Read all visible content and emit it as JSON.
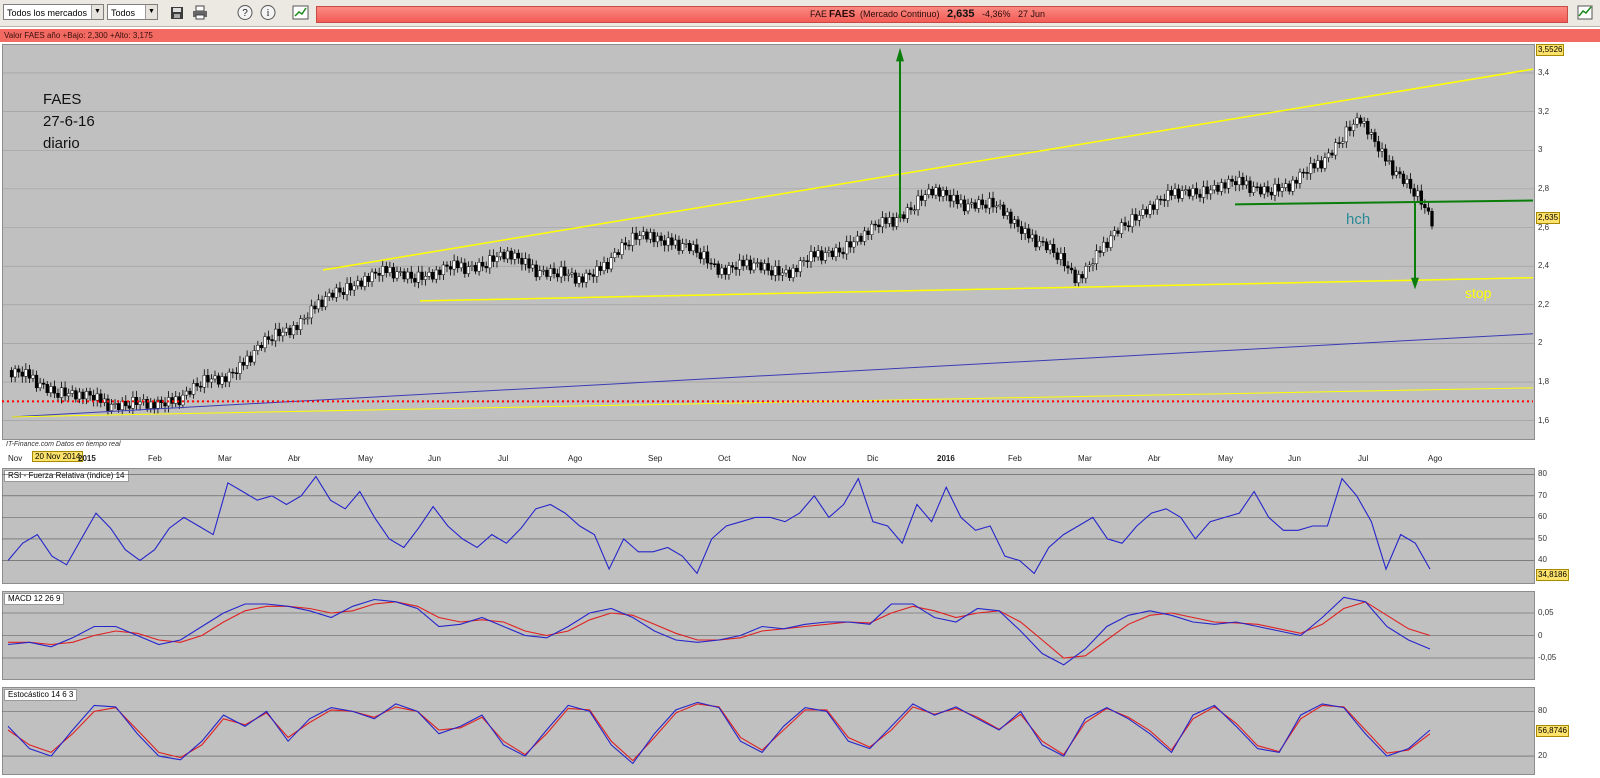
{
  "toolbar": {
    "market_select": "Todos los mercados",
    "type_select": "Todos",
    "icons": [
      "save-icon",
      "print-icon",
      "help-icon",
      "info-icon",
      "chart-type-icon"
    ]
  },
  "ticker": {
    "code": "FAE",
    "name": "FAES",
    "market": "(Mercado Continuo)",
    "price": "2,635",
    "change": "-4,36%",
    "date": "27 Jun"
  },
  "price_header": "Valor   FAES   año +Bajo: 2,300 +Alto: 3,175",
  "annotations": {
    "title": "FAES",
    "date": "27-6-16",
    "period": "diario",
    "pattern": "hch",
    "stop": "stop",
    "credit": "IT-Finance.com  Datos en tiempo real",
    "cursor_date": "20 Nov 2014"
  },
  "colors": {
    "plot_bg": "#c0c0c0",
    "trend_yellow": "#ffff00",
    "arrow_green": "#0a7d0a",
    "rsi_line": "#2525cc",
    "signal_red": "#e02020",
    "support_red": "#ff0000"
  },
  "chart_data": [
    {
      "type": "line",
      "name": "Price (candlestick)",
      "y_axis_ticks": [
        "3,4",
        "3,2",
        "3",
        "2,8",
        "2,6",
        "2,4",
        "2,2",
        "2",
        "1,8",
        "1,6"
      ],
      "ylim": [
        1.5,
        3.55
      ],
      "x_axis_ticks": [
        "Nov",
        "2015",
        "Feb",
        "Mar",
        "Abr",
        "May",
        "Jun",
        "Jul",
        "Ago",
        "Sep",
        "Oct",
        "Nov",
        "Dic",
        "2016",
        "Feb",
        "Mar",
        "Abr",
        "May",
        "Jun",
        "Jul",
        "Ago"
      ],
      "x": [
        "Nov",
        "Dic",
        "2015",
        "Feb",
        "Mar",
        "Abr",
        "May",
        "Jun",
        "Jul",
        "Ago",
        "Sep",
        "Oct",
        "Nov",
        "Dic",
        "2016",
        "Feb",
        "Mar",
        "Abr",
        "May",
        "Jun",
        "Jun-27"
      ],
      "values": [
        1.85,
        1.72,
        1.67,
        1.82,
        2.1,
        2.35,
        2.36,
        2.45,
        2.32,
        2.58,
        2.4,
        2.38,
        2.55,
        2.78,
        2.68,
        2.35,
        2.72,
        2.82,
        2.8,
        3.15,
        2.635
      ],
      "last_value_label": "2,635",
      "top_label": "3,5526",
      "trendlines": [
        {
          "name": "upper-channel",
          "from": [
            "Mar-2015",
            2.38
          ],
          "to": [
            "Ago-2016",
            3.42
          ]
        },
        {
          "name": "lower-channel",
          "from": [
            "May-2015",
            2.22
          ],
          "to": [
            "Ago-2016",
            2.34
          ]
        },
        {
          "name": "neckline",
          "from": [
            "Abr-2016",
            2.72
          ],
          "to": [
            "Ago-2016",
            2.74
          ]
        },
        {
          "name": "blue-support",
          "from": [
            "Nov-2014",
            1.62
          ],
          "to": [
            "Ago-2016",
            2.05
          ]
        },
        {
          "name": "yellow-support",
          "from": [
            "Nov-2014",
            1.62
          ],
          "to": [
            "Ago-2016",
            1.77
          ]
        },
        {
          "name": "red-dotted",
          "from": [
            "Nov-2014",
            1.7
          ],
          "to": [
            "Ago-2016",
            1.7
          ]
        }
      ]
    },
    {
      "type": "line",
      "title": "RSI - Fuerza Relativa (índice) 14",
      "y_axis_ticks": [
        "80",
        "70",
        "60",
        "50",
        "40"
      ],
      "ylim": [
        30,
        82
      ],
      "values": [
        40,
        48,
        52,
        42,
        38,
        50,
        62,
        55,
        45,
        40,
        45,
        55,
        60,
        56,
        52,
        76,
        72,
        68,
        70,
        66,
        70,
        79,
        68,
        64,
        72,
        60,
        50,
        46,
        55,
        65,
        56,
        50,
        46,
        52,
        48,
        55,
        64,
        66,
        62,
        56,
        52,
        36,
        50,
        44,
        44,
        46,
        42,
        34,
        50,
        56,
        58,
        60,
        60,
        58,
        62,
        70,
        60,
        66,
        78,
        58,
        56,
        48,
        66,
        58,
        74,
        60,
        54,
        56,
        42,
        40,
        34,
        46,
        52,
        56,
        60,
        50,
        48,
        56,
        62,
        64,
        60,
        50,
        58,
        60,
        62,
        72,
        60,
        54,
        54,
        56,
        56,
        78,
        70,
        58,
        36,
        52,
        48,
        36
      ],
      "last_value_label": "34,8186"
    },
    {
      "type": "line",
      "title": "MACD 12 26 9",
      "y_axis_ticks": [
        "0,05",
        "0",
        "-0,05"
      ],
      "ylim": [
        -0.09,
        0.09
      ],
      "series": [
        {
          "name": "MACD",
          "values": [
            -0.02,
            -0.015,
            -0.025,
            -0.005,
            0.02,
            0.02,
            0.0,
            -0.02,
            -0.01,
            0.02,
            0.05,
            0.07,
            0.07,
            0.065,
            0.055,
            0.04,
            0.065,
            0.08,
            0.075,
            0.06,
            0.02,
            0.025,
            0.04,
            0.02,
            0.0,
            -0.005,
            0.02,
            0.05,
            0.06,
            0.04,
            0.01,
            -0.01,
            -0.015,
            -0.01,
            0.0,
            0.02,
            0.015,
            0.025,
            0.03,
            0.03,
            0.025,
            0.07,
            0.07,
            0.04,
            0.03,
            0.06,
            0.055,
            0.01,
            -0.04,
            -0.065,
            -0.03,
            0.02,
            0.045,
            0.055,
            0.045,
            0.03,
            0.025,
            0.03,
            0.02,
            0.01,
            0.0,
            0.04,
            0.085,
            0.075,
            0.02,
            -0.01,
            -0.03
          ]
        },
        {
          "name": "Signal",
          "values": [
            -0.015,
            -0.015,
            -0.02,
            -0.015,
            0.0,
            0.01,
            0.005,
            -0.01,
            -0.015,
            0.0,
            0.03,
            0.055,
            0.065,
            0.065,
            0.06,
            0.05,
            0.055,
            0.07,
            0.075,
            0.065,
            0.04,
            0.03,
            0.035,
            0.03,
            0.01,
            0.0,
            0.01,
            0.035,
            0.05,
            0.045,
            0.025,
            0.005,
            -0.01,
            -0.01,
            -0.005,
            0.01,
            0.015,
            0.02,
            0.025,
            0.03,
            0.028,
            0.05,
            0.065,
            0.055,
            0.04,
            0.05,
            0.055,
            0.03,
            -0.01,
            -0.05,
            -0.045,
            -0.01,
            0.025,
            0.045,
            0.05,
            0.04,
            0.03,
            0.028,
            0.025,
            0.015,
            0.005,
            0.025,
            0.06,
            0.075,
            0.045,
            0.015,
            0.0
          ]
        }
      ]
    },
    {
      "type": "line",
      "title": "Estocástico 14 6 3",
      "y_axis_ticks": [
        "80",
        "20"
      ],
      "ylim": [
        0,
        110
      ],
      "last_value_label": "56,8746",
      "series": [
        {
          "name": "%K",
          "values": [
            60,
            30,
            20,
            55,
            88,
            86,
            50,
            20,
            15,
            40,
            75,
            60,
            80,
            40,
            70,
            85,
            80,
            70,
            90,
            80,
            50,
            60,
            75,
            35,
            20,
            55,
            88,
            80,
            35,
            10,
            50,
            82,
            92,
            85,
            40,
            25,
            60,
            85,
            80,
            40,
            30,
            60,
            90,
            75,
            86,
            70,
            55,
            80,
            35,
            20,
            70,
            85,
            70,
            50,
            25,
            75,
            88,
            60,
            30,
            25,
            75,
            90,
            85,
            50,
            20,
            30,
            55
          ]
        },
        {
          "name": "%D",
          "values": [
            55,
            35,
            25,
            50,
            80,
            85,
            55,
            25,
            18,
            35,
            70,
            62,
            78,
            45,
            65,
            82,
            80,
            72,
            86,
            80,
            55,
            58,
            72,
            40,
            22,
            50,
            84,
            82,
            40,
            14,
            45,
            78,
            90,
            86,
            45,
            28,
            55,
            82,
            82,
            45,
            32,
            55,
            86,
            76,
            84,
            72,
            56,
            76,
            40,
            22,
            65,
            84,
            72,
            54,
            28,
            70,
            86,
            64,
            34,
            26,
            70,
            88,
            86,
            55,
            24,
            28,
            50
          ]
        }
      ]
    }
  ]
}
